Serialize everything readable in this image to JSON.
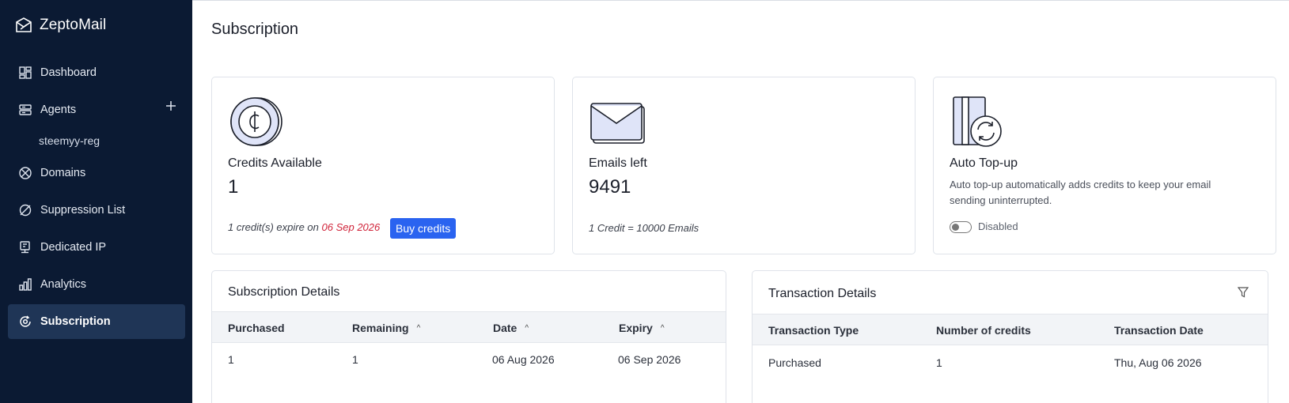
{
  "app": {
    "name": "ZeptoMail"
  },
  "sidebar": {
    "items": [
      {
        "label": "Dashboard",
        "icon": "dashboard-icon"
      },
      {
        "label": "Agents",
        "icon": "agents-icon"
      },
      {
        "label": "Domains",
        "icon": "domains-icon"
      },
      {
        "label": "Suppression List",
        "icon": "suppression-icon"
      },
      {
        "label": "Dedicated IP",
        "icon": "dedicated-ip-icon"
      },
      {
        "label": "Analytics",
        "icon": "analytics-icon"
      },
      {
        "label": "Subscription",
        "icon": "subscription-icon",
        "active": true
      }
    ],
    "sub_item": "steemyy-reg"
  },
  "page": {
    "title": "Subscription"
  },
  "cards": {
    "credits": {
      "title": "Credits Available",
      "value": "1",
      "expire_prefix": "1 credit(s) expire on ",
      "expire_date": "06 Sep 2026",
      "buy_label": "Buy credits"
    },
    "emails": {
      "title": "Emails left",
      "value": "9491",
      "note": "1 Credit = 10000 Emails"
    },
    "topup": {
      "title": "Auto Top-up",
      "desc": "Auto top-up automatically adds credits to keep your email sending uninterrupted.",
      "toggle_label": "Disabled"
    }
  },
  "subscription_details": {
    "title": "Subscription Details",
    "columns": [
      "Purchased",
      "Remaining",
      "Date",
      "Expiry"
    ],
    "rows": [
      [
        "1",
        "1",
        "06 Aug 2026",
        "06 Sep 2026"
      ]
    ]
  },
  "transaction_details": {
    "title": "Transaction Details",
    "columns": [
      "Transaction Type",
      "Number of credits",
      "Transaction Date"
    ],
    "rows": [
      [
        "Purchased",
        "1",
        "Thu, Aug 06 2026"
      ]
    ]
  },
  "colors": {
    "sidebar_bg": "#0b1a33",
    "accent": "#2a63f0",
    "expire": "#d0243a"
  }
}
